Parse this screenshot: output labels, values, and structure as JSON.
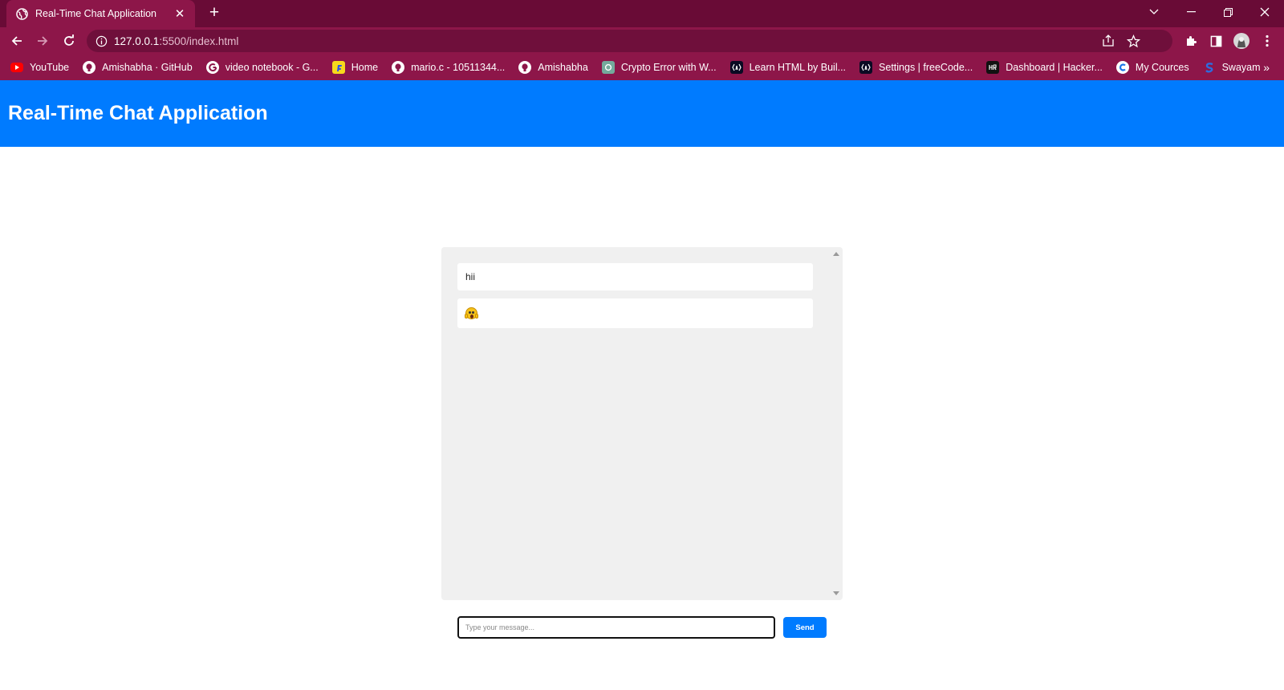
{
  "browser": {
    "tab": {
      "title": "Real-Time Chat Application",
      "close_glyph": "✕"
    },
    "new_tab_glyph": "+",
    "address": {
      "host": "127.0.0.1",
      "path": ":5500/index.html"
    },
    "window_controls": [
      "chevron-down-icon",
      "minimize-icon",
      "restore-icon",
      "close-icon"
    ],
    "bookmarks": [
      {
        "label": "YouTube",
        "icon": "youtube-icon",
        "color": "#ff0000"
      },
      {
        "label": "Amishabha · GitHub",
        "icon": "github-icon",
        "color": "#ffffff"
      },
      {
        "label": "video notebook - G...",
        "icon": "google-icon",
        "color": "#ffffff"
      },
      {
        "label": "Home",
        "icon": "flipkart-icon",
        "color": "#f7d91c"
      },
      {
        "label": "mario.c - 10511344...",
        "icon": "github-icon",
        "color": "#ffffff"
      },
      {
        "label": "Amishabha",
        "icon": "github-icon",
        "color": "#ffffff"
      },
      {
        "label": "Crypto Error with W...",
        "icon": "openai-icon",
        "color": "#74aa9c"
      },
      {
        "label": "Learn HTML by Buil...",
        "icon": "freecodecamp-icon",
        "color": "#0a0a23"
      },
      {
        "label": "Settings | freeCode...",
        "icon": "freecodecamp-icon",
        "color": "#0a0a23"
      },
      {
        "label": "Dashboard | Hacker...",
        "icon": "hackerrank-icon",
        "color": "#111111"
      },
      {
        "label": "My Cources",
        "icon": "coursera-icon",
        "color": "#1a73e8"
      },
      {
        "label": "Swayam",
        "icon": "swayam-icon",
        "color": "#2d6cdf"
      }
    ],
    "bookmarks_more_glyph": "»"
  },
  "app": {
    "title": "Real-Time Chat Application",
    "messages": [
      {
        "text": "hii"
      },
      {
        "text": "",
        "emoji": "face-screaming-in-fear-emoji"
      }
    ],
    "input": {
      "placeholder": "Type your message...",
      "value": ""
    },
    "send_label": "Send"
  },
  "colors": {
    "tabstrip": "#690b36",
    "toolbar": "#8d1649",
    "header": "#007bff",
    "chat_bg": "#f0f0f0",
    "send_button": "#007bff"
  }
}
